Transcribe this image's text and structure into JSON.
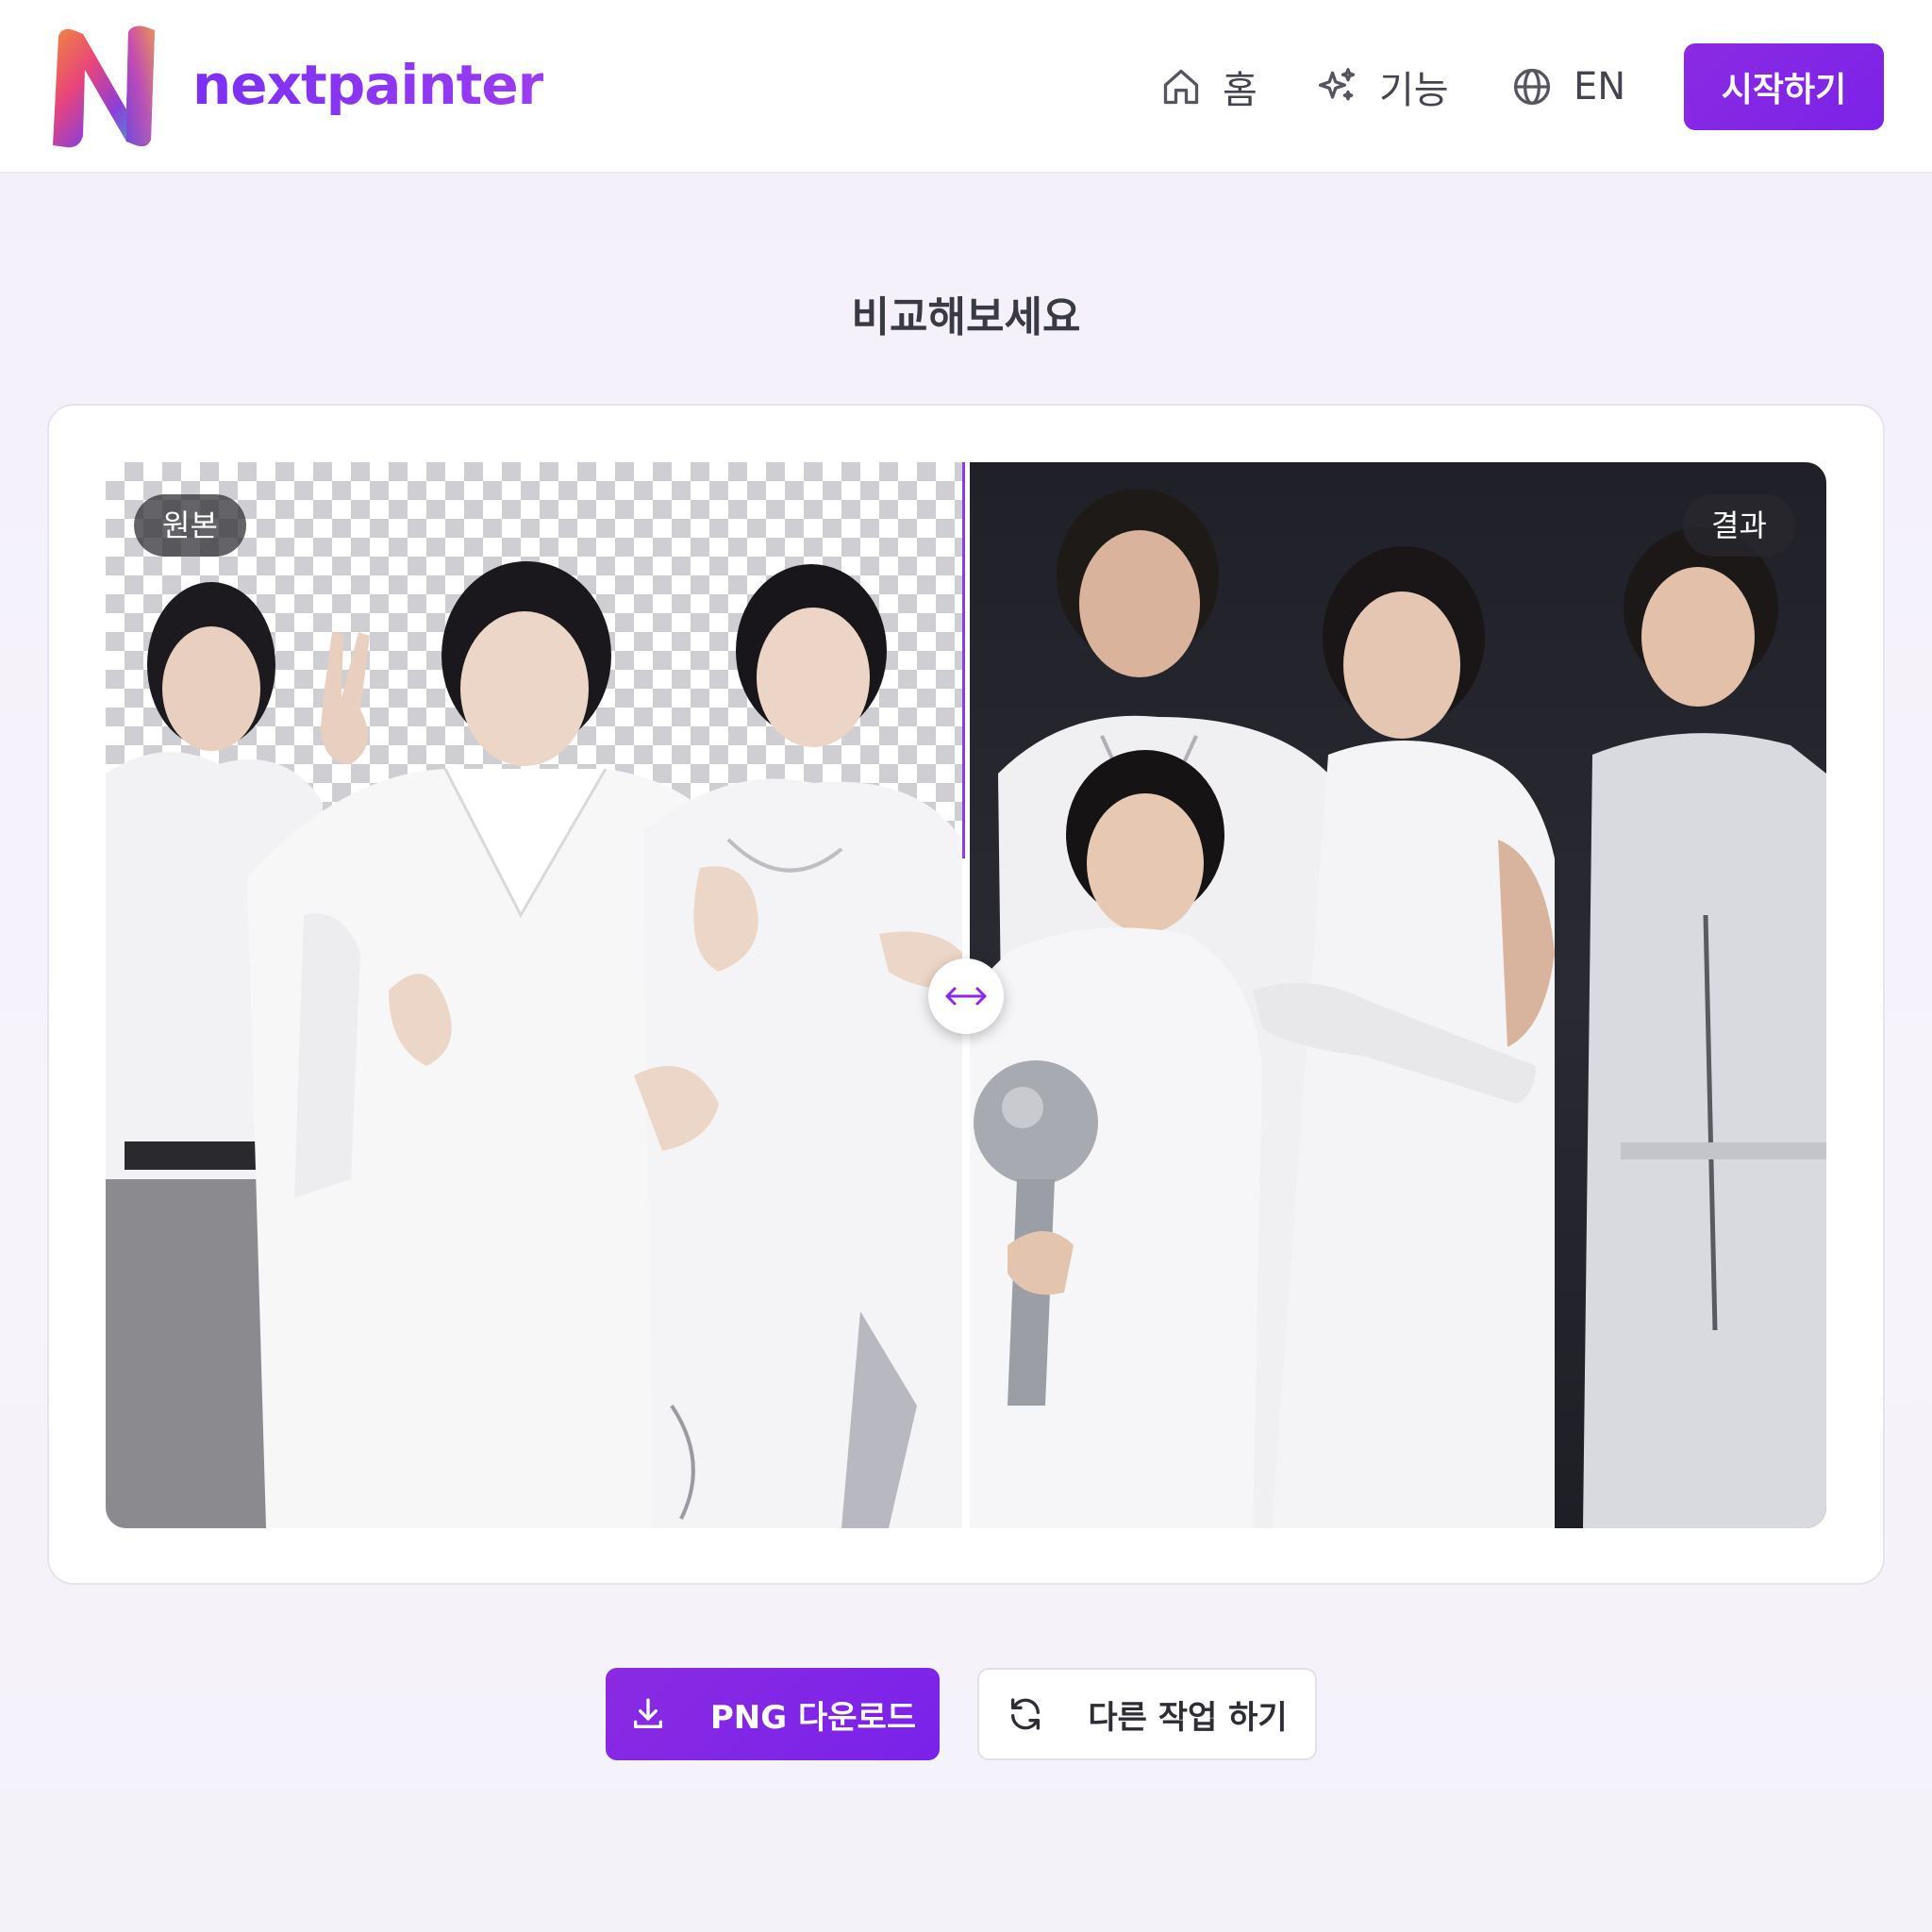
{
  "header": {
    "brand": "nextpainter",
    "nav": {
      "home": "홈",
      "features": "기능",
      "language": "EN"
    },
    "cta": "시작하기"
  },
  "main": {
    "title": "비교해보세요",
    "compare": {
      "left_tag": "원본",
      "right_tag": "결과"
    },
    "actions": {
      "download": "PNG 다운로드",
      "redo": "다른 작업 하기"
    }
  },
  "colors": {
    "brand": "#8a2be2",
    "button_bg": "#7c22e8",
    "page_bg": "#f3f0fa"
  },
  "icons": {
    "home": "home-icon",
    "features": "sparkles-icon",
    "language": "globe-icon",
    "download": "download-icon",
    "redo": "refresh-icon",
    "handle": "arrows-horizontal-icon"
  }
}
